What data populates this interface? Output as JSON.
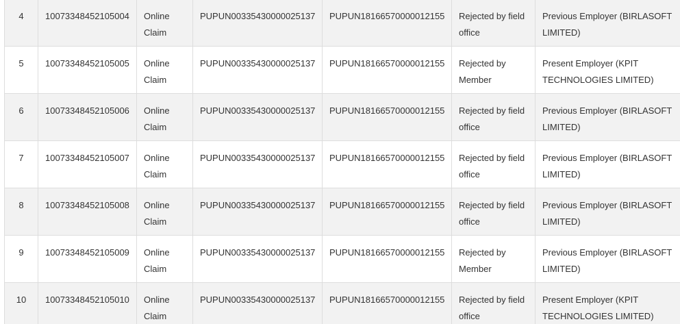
{
  "rows": [
    {
      "sno": "4",
      "claim_id": "10073348452105004",
      "mode": "Online Claim",
      "member_id": "PUPUN00335430000025137",
      "establishment_id": "PUPUN18166570000012155",
      "status": "Rejected by field office",
      "employer": "Previous Employer (BIRLASOFT LIMITED)"
    },
    {
      "sno": "5",
      "claim_id": "10073348452105005",
      "mode": "Online Claim",
      "member_id": "PUPUN00335430000025137",
      "establishment_id": "PUPUN18166570000012155",
      "status": "Rejected by Member",
      "employer": "Present Employer (KPIT TECHNOLOGIES LIMITED)"
    },
    {
      "sno": "6",
      "claim_id": "10073348452105006",
      "mode": "Online Claim",
      "member_id": "PUPUN00335430000025137",
      "establishment_id": "PUPUN18166570000012155",
      "status": "Rejected by field office",
      "employer": "Previous Employer (BIRLASOFT LIMITED)"
    },
    {
      "sno": "7",
      "claim_id": "10073348452105007",
      "mode": "Online Claim",
      "member_id": "PUPUN00335430000025137",
      "establishment_id": "PUPUN18166570000012155",
      "status": "Rejected by field office",
      "employer": "Previous Employer (BIRLASOFT LIMITED)"
    },
    {
      "sno": "8",
      "claim_id": "10073348452105008",
      "mode": "Online Claim",
      "member_id": "PUPUN00335430000025137",
      "establishment_id": "PUPUN18166570000012155",
      "status": "Rejected by field office",
      "employer": "Previous Employer (BIRLASOFT LIMITED)"
    },
    {
      "sno": "9",
      "claim_id": "10073348452105009",
      "mode": "Online Claim",
      "member_id": "PUPUN00335430000025137",
      "establishment_id": "PUPUN18166570000012155",
      "status": "Rejected by Member",
      "employer": "Previous Employer (BIRLASOFT LIMITED)"
    },
    {
      "sno": "10",
      "claim_id": "10073348452105010",
      "mode": "Online Claim",
      "member_id": "PUPUN00335430000025137",
      "establishment_id": "PUPUN18166570000012155",
      "status": "Rejected by field office",
      "employer": "Present Employer (KPIT TECHNOLOGIES LIMITED)"
    }
  ]
}
